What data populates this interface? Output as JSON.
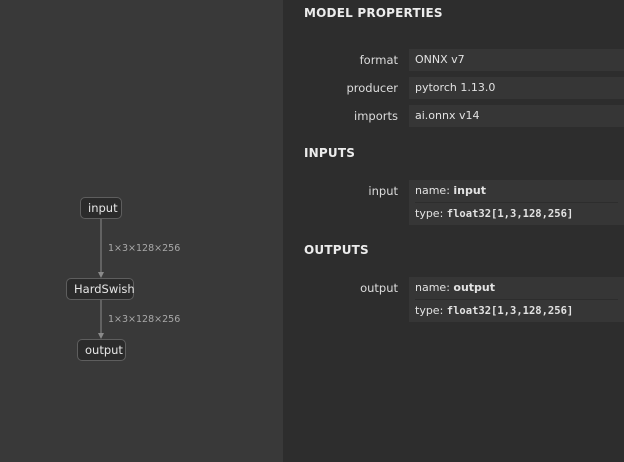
{
  "graph": {
    "nodes": {
      "input": "input",
      "hardswish": "HardSwish",
      "output": "output"
    },
    "edges": {
      "input_to_hardswish": "1×3×128×256",
      "hardswish_to_output": "1×3×128×256"
    }
  },
  "sidebar": {
    "title": "MODEL PROPERTIES",
    "properties": [
      {
        "label": "format",
        "value": "ONNX v7"
      },
      {
        "label": "producer",
        "value": "pytorch 1.13.0"
      },
      {
        "label": "imports",
        "value": "ai.onnx v14"
      }
    ],
    "inputs": {
      "title": "INPUTS",
      "items": [
        {
          "label": "input",
          "name_prefix": "name:",
          "name": "input",
          "type_prefix": "type:",
          "type": "float32[1,3,128,256]"
        }
      ]
    },
    "outputs": {
      "title": "OUTPUTS",
      "items": [
        {
          "label": "output",
          "name_prefix": "name:",
          "name": "output",
          "type_prefix": "type:",
          "type": "float32[1,3,128,256]"
        }
      ]
    }
  },
  "colors": {
    "canvas": "#393939",
    "sidebar": "#2d2d2d",
    "node": "#2b2b2b",
    "edge": "#8a8a8a"
  }
}
